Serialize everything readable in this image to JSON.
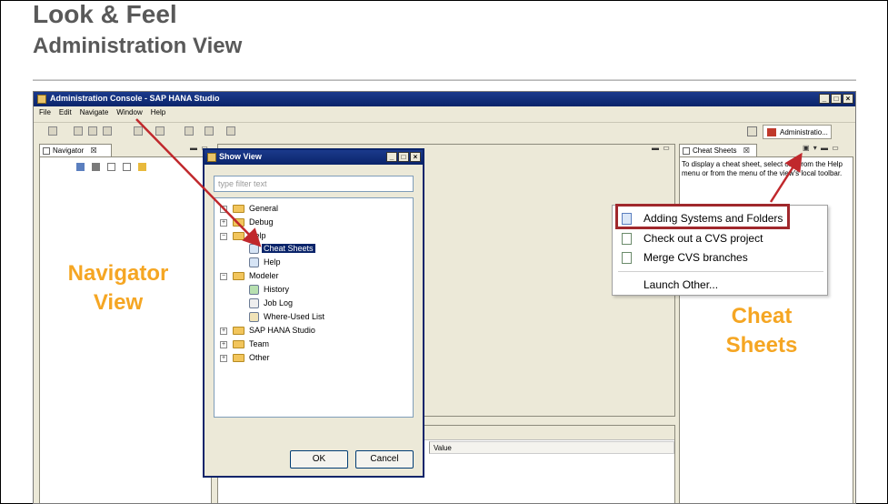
{
  "slide": {
    "title": "Look & Feel",
    "subtitle": "Administration View"
  },
  "window": {
    "title": "Administration Console - SAP HANA Studio",
    "controls": [
      "_",
      "□",
      "×"
    ]
  },
  "menu": [
    "File",
    "Edit",
    "Navigate",
    "Window",
    "Help"
  ],
  "perspective": {
    "label": "Administratio..."
  },
  "navigator": {
    "tab_label": "Navigator",
    "close": "☒",
    "callout_line1": "Navigator",
    "callout_line2": "View"
  },
  "show_view": {
    "title": "Show View",
    "controls": [
      "_",
      "□",
      "×"
    ],
    "filter_placeholder": "type filter text",
    "tree": {
      "general": "General",
      "debug": "Debug",
      "help_folder": "Help",
      "cheat_sheets": "Cheat Sheets",
      "help_item": "Help",
      "modeler": "Modeler",
      "history": "History",
      "job_log": "Job Log",
      "where_used": "Where-Used List",
      "sap_hana_studio": "SAP HANA Studio",
      "team": "Team",
      "other": "Other"
    },
    "ok_label": "OK",
    "cancel_label": "Cancel"
  },
  "properties": {
    "value_header": "Value"
  },
  "cheat_sheets": {
    "tab_label": "Cheat Sheets",
    "close": "☒",
    "hint": "To display a cheat sheet, select one from the Help menu or from the menu of the view's local toolbar.",
    "menu_items": [
      "Adding Systems and Folders",
      "Check out a CVS project",
      "Merge CVS branches",
      "Launch Other..."
    ],
    "callout_line1": "Cheat",
    "callout_line2": "Sheets"
  },
  "colors": {
    "callout": "#f5a623",
    "arrow": "#c0282c",
    "titlebar": "#0a246a"
  }
}
